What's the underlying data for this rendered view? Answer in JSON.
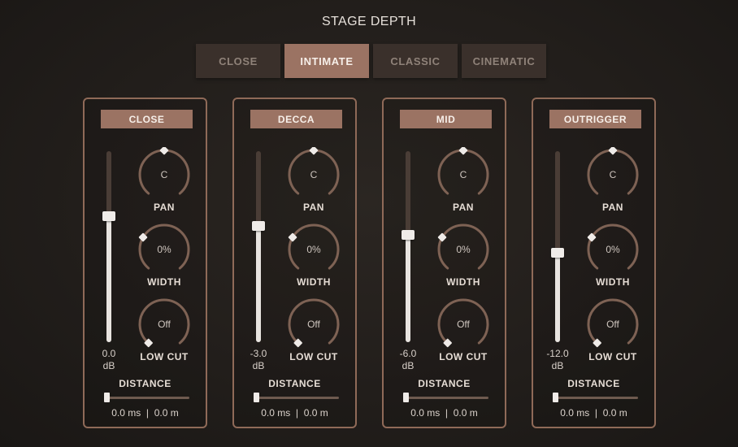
{
  "header": {
    "title": "STAGE DEPTH"
  },
  "tabs": [
    {
      "label": "CLOSE",
      "active": false
    },
    {
      "label": "INTIMATE",
      "active": true
    },
    {
      "label": "CLASSIC",
      "active": false
    },
    {
      "label": "CINEMATIC",
      "active": false
    }
  ],
  "colors": {
    "accent": "#9b7363",
    "panel_border": "#8f6a58",
    "background": "#231f1c"
  },
  "panels": [
    {
      "name": "CLOSE",
      "fader": {
        "value_line1": "0.0",
        "value_line2": "dB",
        "level": 0.66
      },
      "pan": {
        "value": "C",
        "label": "PAN"
      },
      "width": {
        "value": "0%",
        "label": "WIDTH"
      },
      "low_cut": {
        "value": "Off",
        "label": "LOW CUT"
      },
      "distance": {
        "label": "DISTANCE",
        "ms": "0.0 ms",
        "m": "0.0 m",
        "level": 0
      }
    },
    {
      "name": "DECCA",
      "fader": {
        "value_line1": "-3.0",
        "value_line2": "dB",
        "level": 0.61
      },
      "pan": {
        "value": "C",
        "label": "PAN"
      },
      "width": {
        "value": "0%",
        "label": "WIDTH"
      },
      "low_cut": {
        "value": "Off",
        "label": "LOW CUT"
      },
      "distance": {
        "label": "DISTANCE",
        "ms": "0.0 ms",
        "m": "0.0 m",
        "level": 0
      }
    },
    {
      "name": "MID",
      "fader": {
        "value_line1": "-6.0",
        "value_line2": "dB",
        "level": 0.56
      },
      "pan": {
        "value": "C",
        "label": "PAN"
      },
      "width": {
        "value": "0%",
        "label": "WIDTH"
      },
      "low_cut": {
        "value": "Off",
        "label": "LOW CUT"
      },
      "distance": {
        "label": "DISTANCE",
        "ms": "0.0 ms",
        "m": "0.0 m",
        "level": 0
      }
    },
    {
      "name": "OUTRIGGER",
      "fader": {
        "value_line1": "-12.0",
        "value_line2": "dB",
        "level": 0.47
      },
      "pan": {
        "value": "C",
        "label": "PAN"
      },
      "width": {
        "value": "0%",
        "label": "WIDTH"
      },
      "low_cut": {
        "value": "Off",
        "label": "LOW CUT"
      },
      "distance": {
        "label": "DISTANCE",
        "ms": "0.0 ms",
        "m": "0.0 m",
        "level": 0
      }
    }
  ]
}
